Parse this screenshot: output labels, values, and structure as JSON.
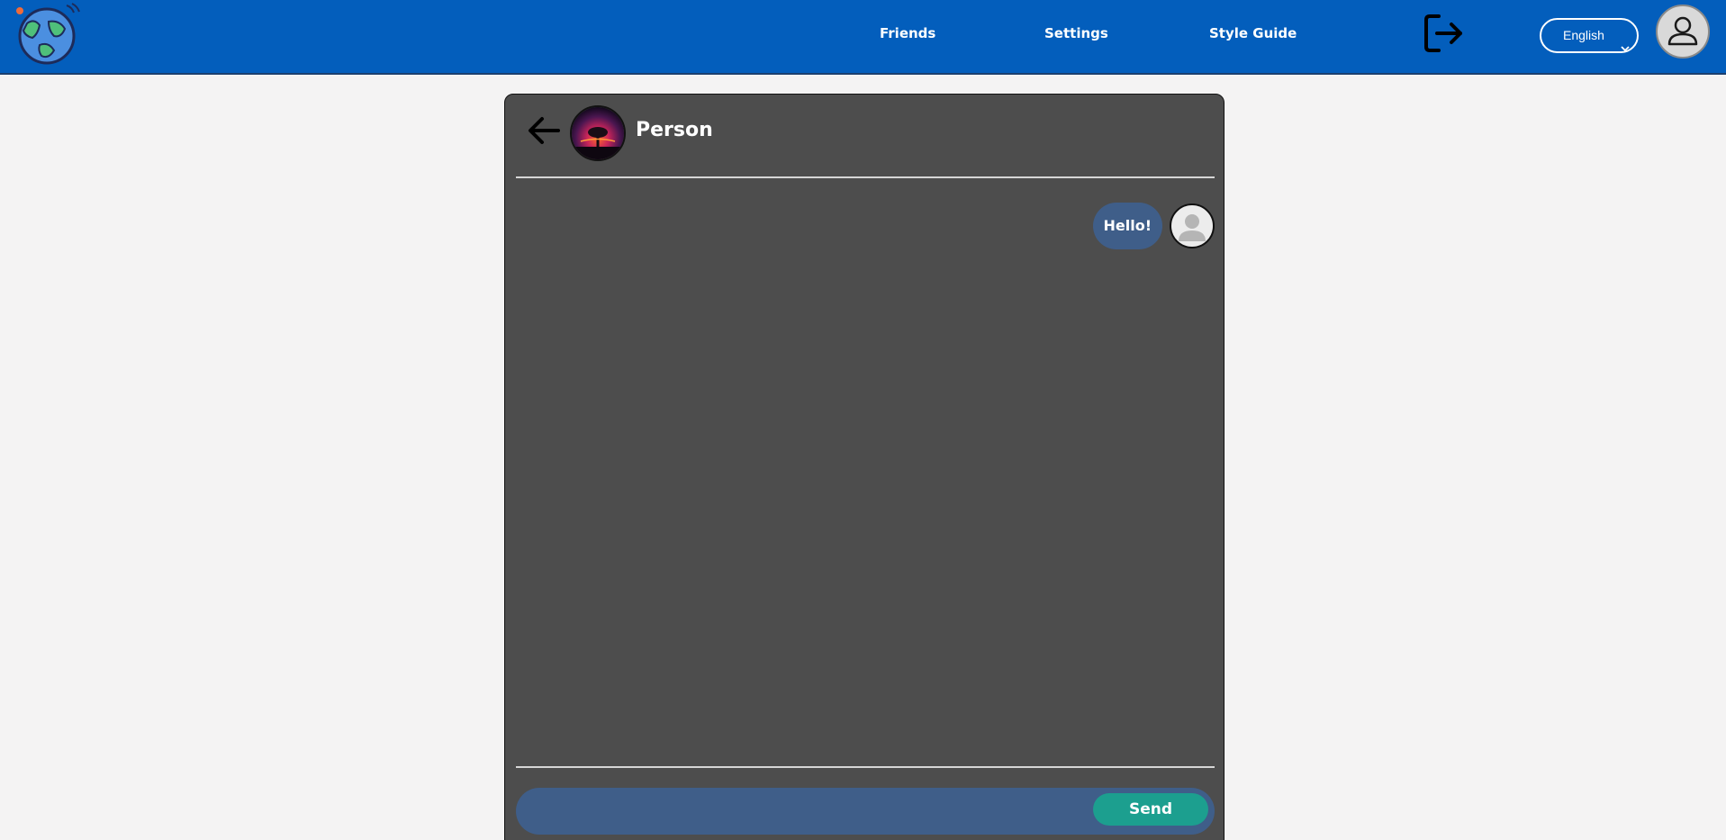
{
  "header": {
    "logo_icon": "globe-logo-icon",
    "nav": [
      {
        "label": "Friends"
      },
      {
        "label": "Settings"
      },
      {
        "label": "Style Guide"
      }
    ],
    "logout_icon": "logout-icon",
    "language": {
      "selected": "English"
    },
    "profile_icon": "user-icon",
    "colors": {
      "bar": "#035ebc"
    }
  },
  "chat": {
    "back_icon": "arrow-left-icon",
    "contact": {
      "name": "Person"
    },
    "messages": [
      {
        "text": "Hello!",
        "from": "me"
      }
    ],
    "composer": {
      "placeholder": "",
      "value": ""
    },
    "send_label": "Send",
    "colors": {
      "panel": "#4d4d4d",
      "bubble": "#3f5e89",
      "send": "#1c9f8f"
    }
  }
}
